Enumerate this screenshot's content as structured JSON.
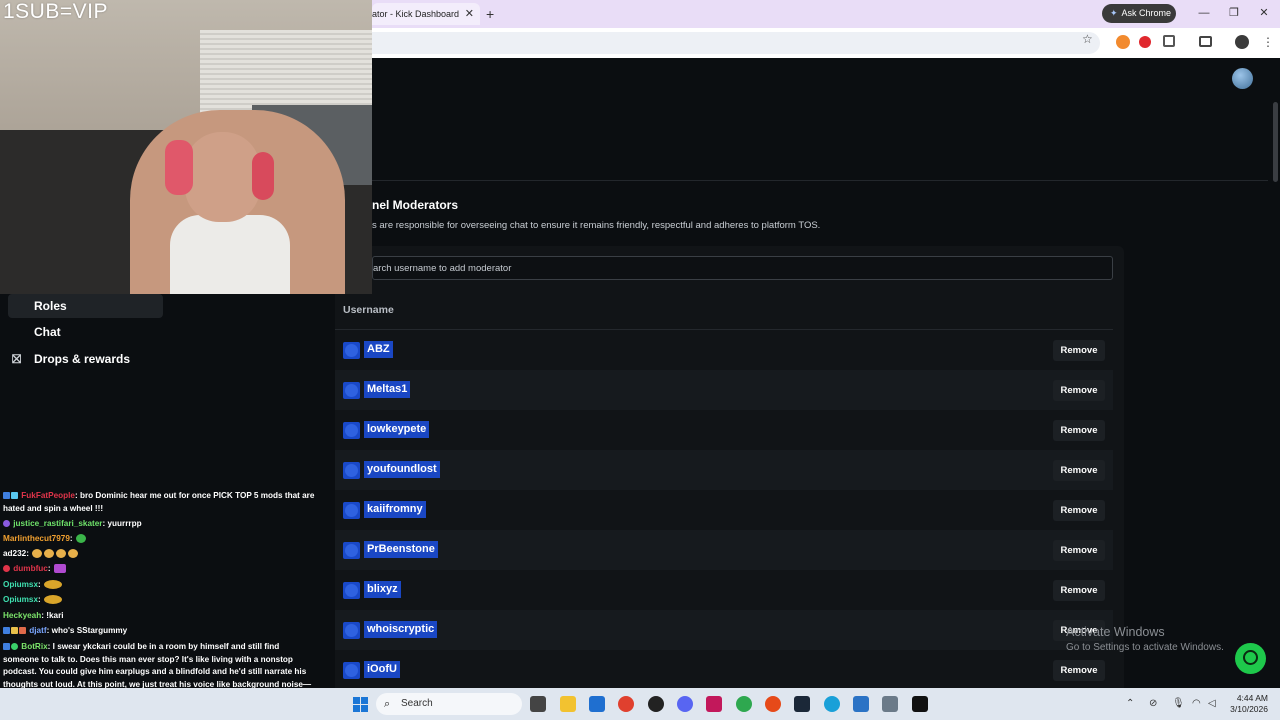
{
  "browser": {
    "tab_title": "ator - Kick Dashboard",
    "tab_close": "✕",
    "new_tab": "+",
    "ask_chrome": "Ask Chrome",
    "star": "☆"
  },
  "webcam": {
    "overlay_text": "1SUB=VIP"
  },
  "sidebar": {
    "items": [
      {
        "label": "Roles",
        "active": true
      },
      {
        "label": "Chat",
        "active": false
      },
      {
        "label": "Drops & rewards",
        "active": false,
        "icon": "gift-icon"
      }
    ]
  },
  "moderators": {
    "title": "nel Moderators",
    "description": "s are responsible for overseeing chat to ensure it remains friendly, respectful and adheres to platform TOS.",
    "search_placeholder": "arch username to add moderator",
    "column_header": "Username",
    "remove_label": "Remove",
    "rows": [
      {
        "username": "ABZ"
      },
      {
        "username": "Meltas1"
      },
      {
        "username": "lowkeypete"
      },
      {
        "username": "youfoundlost"
      },
      {
        "username": "kaiifromny"
      },
      {
        "username": "PrBeenstone"
      },
      {
        "username": "blixyz"
      },
      {
        "username": "whoiscryptic"
      },
      {
        "username": "iOofU"
      }
    ]
  },
  "watermark": {
    "line1": "Activate Windows",
    "line2": "Go to Settings to activate Windows."
  },
  "chat": {
    "messages": [
      {
        "user": "FukFatPeople",
        "color": "#e0344a",
        "text": ": bro Dominic hear me out for once PICK TOP 5 mods that are hated and spin a wheel !!!"
      },
      {
        "user": "justice_rastifari_skater",
        "color": "#6fe36a",
        "text": ": yuurrrpp"
      },
      {
        "user": "Marlinthecut7979",
        "color": "#f0a030",
        "text": ":"
      },
      {
        "user": "ad232",
        "color": "#ffffff",
        "text": ":"
      },
      {
        "user": "dumbfuc",
        "color": "#e0344a",
        "text": ":"
      },
      {
        "user": "Opiumsx",
        "color": "#3fe0b0",
        "text": ":"
      },
      {
        "user": "Opiumsx",
        "color": "#3fe0b0",
        "text": ":"
      },
      {
        "user": "Heckyeah",
        "color": "#7be36a",
        "text": ": !kari"
      },
      {
        "user": "djatf",
        "color": "#7aa6ff",
        "text": ": who's SStargummy"
      },
      {
        "user": "BotRix",
        "color": "#7be36a",
        "text": ": I swear ykckari could be in a room by himself and still find someone to talk to. Does this man ever stop? It's like living with a nonstop podcast. You could give him earplugs and a blindfold and he'd still narrate his thoughts out loud. At this point, we just treat his voice like background noise—he will never be quiet, and we've all accepted it."
      }
    ]
  },
  "taskbar": {
    "search_label": "Search",
    "time": "4:44 AM",
    "date": "3/10/2026"
  },
  "colors": {
    "kick_green": "#1ec84b",
    "selection_blue": "#1a47c4",
    "page_bg": "#0b0e11"
  }
}
